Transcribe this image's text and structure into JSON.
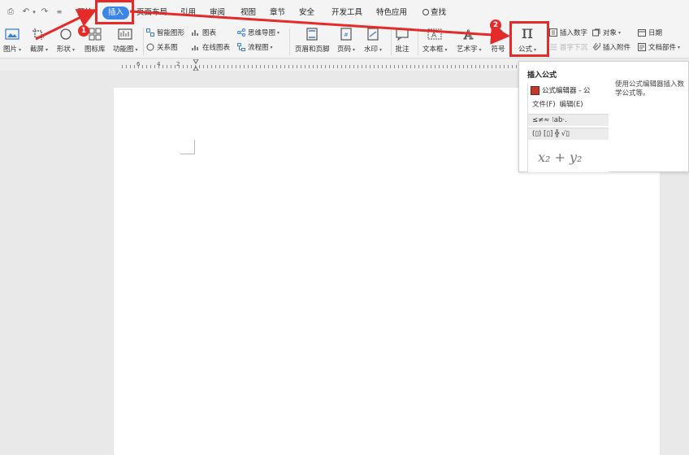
{
  "menubar": {
    "tabs": [
      {
        "id": "start",
        "label": "开始"
      },
      {
        "id": "insert",
        "label": "插入",
        "active": true
      },
      {
        "id": "layout",
        "label": "页面布局"
      },
      {
        "id": "reference",
        "label": "引用"
      },
      {
        "id": "review",
        "label": "审阅"
      },
      {
        "id": "view",
        "label": "视图"
      },
      {
        "id": "chapter",
        "label": "章节"
      },
      {
        "id": "security",
        "label": "安全"
      },
      {
        "id": "devtools",
        "label": "开发工具"
      },
      {
        "id": "features",
        "label": "特色应用"
      }
    ],
    "search_label": "查找"
  },
  "ribbon": {
    "picture": "图片",
    "screenshot": "截屏",
    "shape": "形状",
    "icon_lib": "图标库",
    "function_chart": "功能图",
    "smart_graphic": "智能图形",
    "chart": "图表",
    "mindmap": "思维导图",
    "relation_chart": "关系图",
    "online_chart": "在线图表",
    "flowchart": "流程图",
    "header_footer": "页眉和页脚",
    "page_number": "页码",
    "watermark": "水印",
    "comment": "批注",
    "textbox": "文本框",
    "wordart": "艺术字",
    "symbol": "符号",
    "formula": "公式",
    "insert_number": "插入数字",
    "object": "对象",
    "date": "日期",
    "dropcap": "首字下沉",
    "attachment": "插入附件",
    "doc_parts": "文档部件"
  },
  "ruler": {
    "labels": [
      "6",
      "4",
      "2"
    ]
  },
  "tooltip": {
    "title": "插入公式",
    "description": "使用公式编辑器插入数学公式等。",
    "preview": {
      "window_title": "公式编辑器 - 公",
      "menu": [
        "文件(F)",
        "编辑(E)"
      ],
      "row1": "≤≠≈  ⁝ab·.",
      "row2": "(▯) [▯]  ╬ √▯",
      "formula": "x₂ + y₂"
    }
  },
  "annotations": {
    "step1": "1",
    "step2": "2",
    "color": "#e52a2a"
  },
  "colors": {
    "accent": "#3b84e8",
    "ribbon_bg": "#f4f4f4",
    "workspace_bg": "#e9e9e9"
  }
}
